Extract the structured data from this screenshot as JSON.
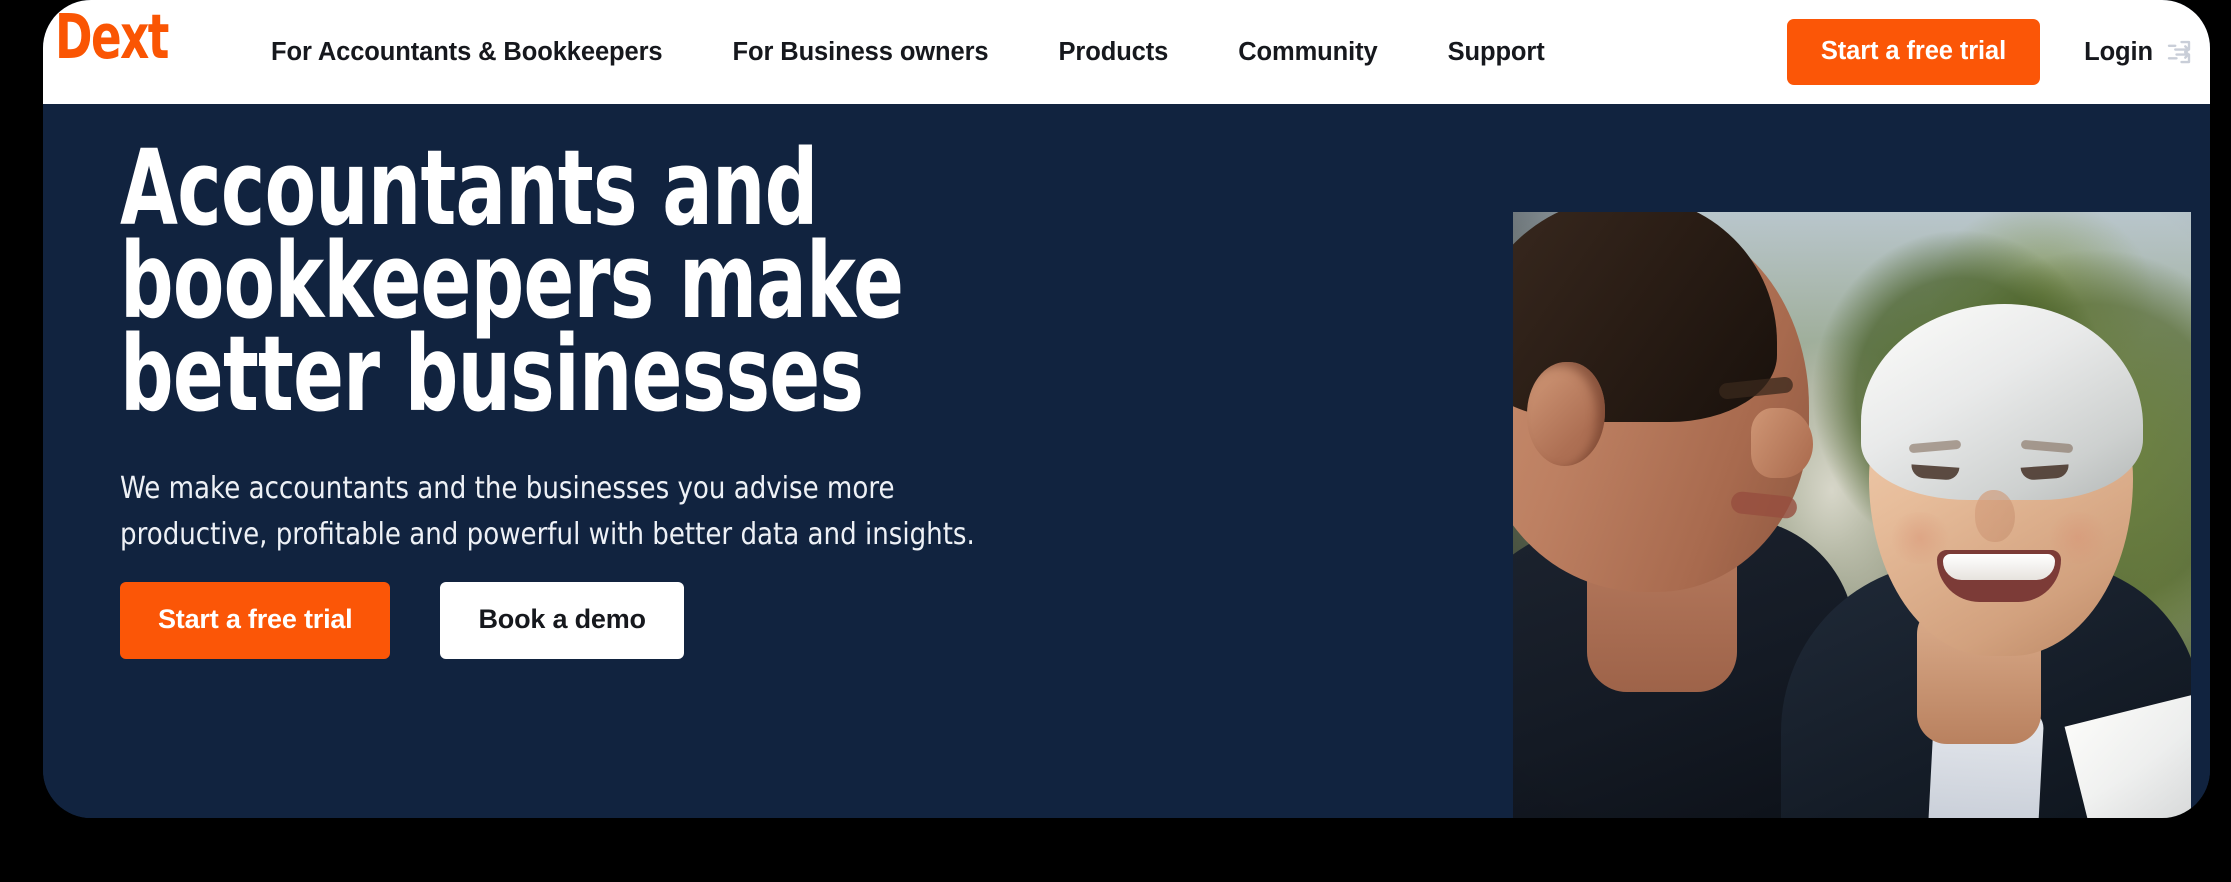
{
  "brand": {
    "name": "Dext",
    "logo_color": "#fa5503"
  },
  "header": {
    "nav_items": [
      {
        "label": "For Accountants & Bookkeepers"
      },
      {
        "label": "For Business owners"
      },
      {
        "label": "Products"
      },
      {
        "label": "Community"
      },
      {
        "label": "Support"
      }
    ],
    "cta_label": "Start a free trial",
    "login_label": "Login",
    "login_icon": "login-enter-icon",
    "cta_color": "#fb5607",
    "background_color": "#ffffff",
    "text_color": "#16181d"
  },
  "hero": {
    "title": "Accountants and\nbookkeepers make\nbetter businesses",
    "subtitle": "We make accountants and the businesses you advise more productive, profitable and powerful with better data and insights.",
    "primary_cta_label": "Start a free trial",
    "secondary_cta_label": "Book a demo",
    "background_color": "#11233f",
    "title_color": "#ffffff",
    "image_alt": "Two business professionals smiling outdoors — a man seen in profile facing a silver-haired woman in a dark suit holding a document"
  }
}
